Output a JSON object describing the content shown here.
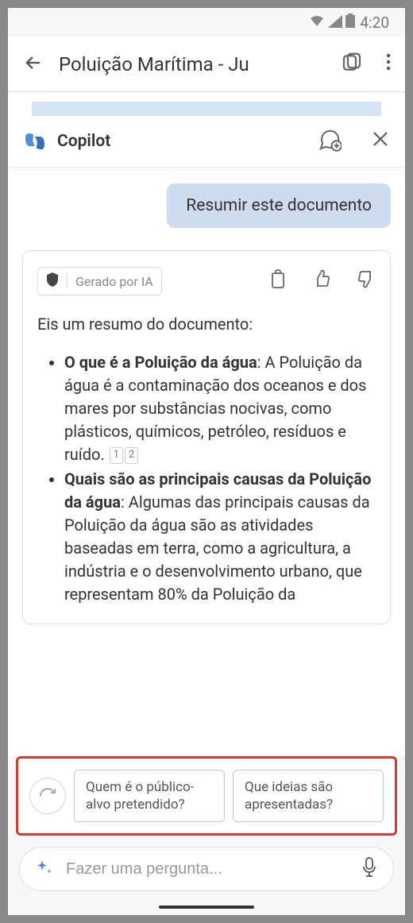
{
  "status": {
    "time": "4:20"
  },
  "header": {
    "doc_title": "Poluição Marítima - Ju"
  },
  "copilot": {
    "title": "Copilot"
  },
  "chat": {
    "user_message": "Resumir este documento",
    "ai_badge": "Gerado por IA",
    "summary_intro": "Eis um resumo do documento:",
    "items": [
      {
        "title": "O que é a Poluição da água",
        "body": "A Poluição da água é a contaminação dos oceanos e dos mares por substâncias nocivas, como plásticos, químicos, petróleo, resíduos e ruído.",
        "refs": [
          "1",
          "2"
        ]
      },
      {
        "title": "Quais são as principais causas da Poluição da água",
        "body": "Algumas das principais causas da Poluição da água são as atividades baseadas em terra, como a agricultura, a indústria e o desenvolvimento urbano, que representam 80% da Poluição da",
        "refs": []
      }
    ]
  },
  "suggestions": {
    "chip1": "Quem é o público-alvo pretendido?",
    "chip2": "Que ideias são apresentadas?"
  },
  "input": {
    "placeholder": "Fazer uma pergunta..."
  }
}
